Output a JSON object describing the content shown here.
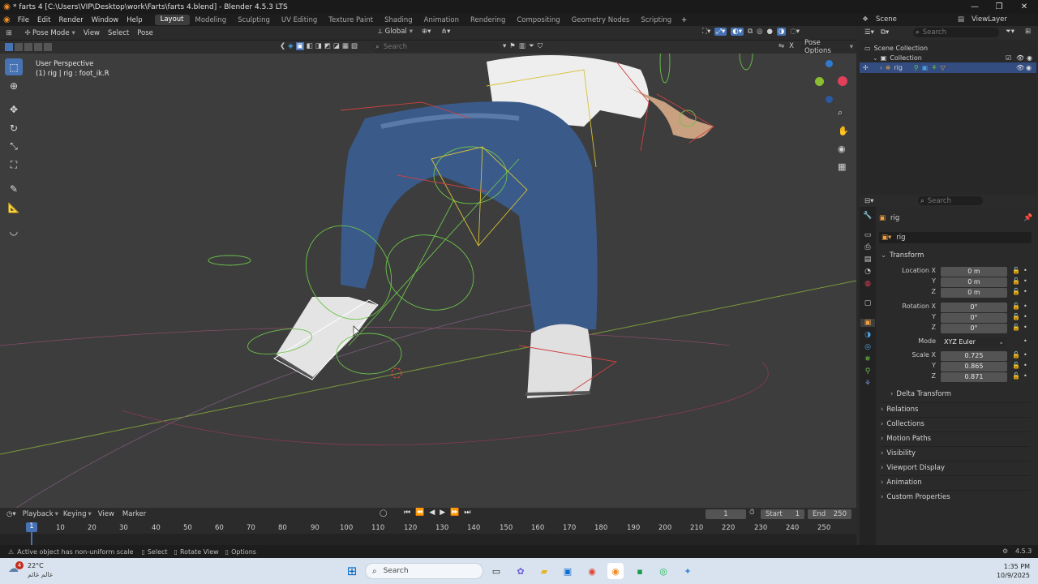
{
  "window": {
    "title": "* farts 4 [C:\\Users\\VIP\\Desktop\\work\\Farts\\farts 4.blend] - Blender 4.5.3 LTS",
    "controls": [
      "—",
      "❐",
      "✕"
    ]
  },
  "menubar": {
    "items": [
      "File",
      "Edit",
      "Render",
      "Window",
      "Help"
    ],
    "workspaces": [
      "Layout",
      "Modeling",
      "Sculpting",
      "UV Editing",
      "Texture Paint",
      "Shading",
      "Animation",
      "Rendering",
      "Compositing",
      "Geometry Nodes",
      "Scripting"
    ],
    "active_workspace": "Layout",
    "add": "+",
    "scene": "Scene",
    "view_layer": "ViewLayer"
  },
  "viewport_header": {
    "mode": "Pose Mode",
    "menus": [
      "View",
      "Select",
      "Pose"
    ],
    "transform_orientation": "Global",
    "pose_options": "Pose Options",
    "search_placeholder": "Search"
  },
  "viewport": {
    "perspective": "User Perspective",
    "active": "(1) rig | rig : foot_ik.R"
  },
  "outliner": {
    "search_placeholder": "Search",
    "scene_collection": "Scene Collection",
    "collection": "Collection",
    "rig": "rig"
  },
  "properties": {
    "search_placeholder": "Search",
    "object_name": "rig",
    "data_name": "rig",
    "transform_label": "Transform",
    "location": {
      "label": "Location X",
      "y": "Y",
      "z": "Z",
      "x_val": "0 m",
      "y_val": "0 m",
      "z_val": "0 m"
    },
    "rotation": {
      "label": "Rotation X",
      "y": "Y",
      "z": "Z",
      "x_val": "0°",
      "y_val": "0°",
      "z_val": "0°"
    },
    "mode": {
      "label": "Mode",
      "value": "XYZ Euler"
    },
    "scale": {
      "label": "Scale X",
      "y": "Y",
      "z": "Z",
      "x_val": "0.725",
      "y_val": "0.865",
      "z_val": "0.871"
    },
    "delta_transform": "Delta Transform",
    "panels": [
      "Relations",
      "Collections",
      "Motion Paths",
      "Visibility",
      "Viewport Display",
      "Animation",
      "Custom Properties"
    ]
  },
  "timeline": {
    "menus": [
      "Playback",
      "Keying",
      "View",
      "Marker"
    ],
    "current_frame": "1",
    "start_label": "Start",
    "start": "1",
    "end_label": "End",
    "end": "250",
    "ticks": [
      "1",
      "10",
      "20",
      "30",
      "40",
      "50",
      "60",
      "70",
      "80",
      "90",
      "100",
      "110",
      "120",
      "130",
      "140",
      "150",
      "160",
      "170",
      "180",
      "190",
      "200",
      "210",
      "220",
      "230",
      "240",
      "250"
    ]
  },
  "statusbar": {
    "warning": "Active object has non-uniform scale",
    "hints": [
      "Select",
      "Rotate View",
      "Options"
    ],
    "version": "4.5.3"
  },
  "taskbar": {
    "weather_temp": "22°C",
    "weather_text": "عالم غائم",
    "notification_count": "4",
    "search_placeholder": "Search",
    "time": "1:35 PM",
    "date": "10/9/2025"
  },
  "colors": {
    "accent": "#4772b3",
    "viewport_bg": "#3d3d3d",
    "bone_green": "#6cc24a",
    "bone_yellow": "#d6c234",
    "bone_red": "#d04040"
  }
}
